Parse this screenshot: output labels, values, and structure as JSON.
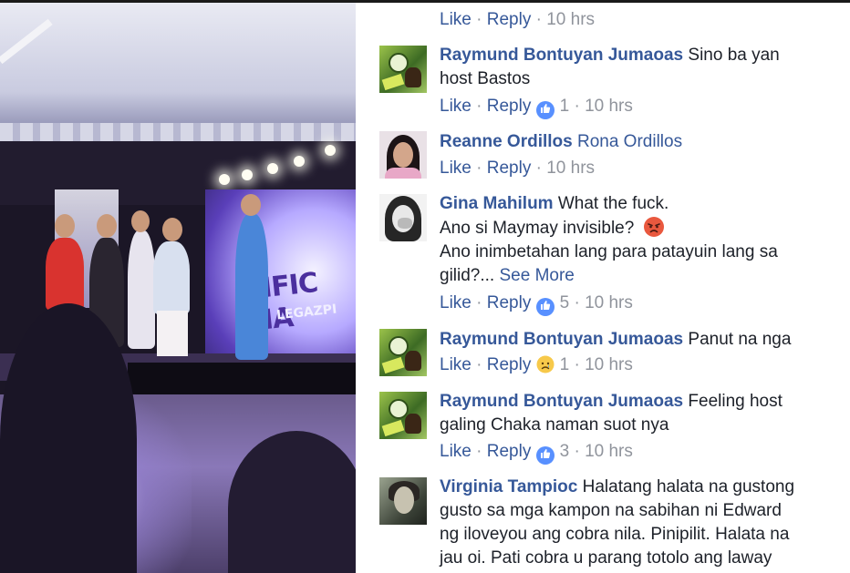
{
  "actions": {
    "like": "Like",
    "reply": "Reply",
    "separator": "·"
  },
  "colors": {
    "link": "#365899",
    "meta": "#90949c",
    "text": "#1d2129",
    "like_blue": "#5890ff"
  },
  "video": {
    "screen_logo_text": "CIFIC MA",
    "screen_logo_sub": "LEGAZPI"
  },
  "first_row": {
    "time": "10 hrs"
  },
  "comments": [
    {
      "author": "Raymund Bontuyan Jumaoas",
      "text_line1": "Sino ba yan",
      "text_line2": "host Bastos",
      "reaction": {
        "icon": "like-icon",
        "count": "1"
      },
      "time": "10 hrs"
    },
    {
      "author": "Reanne Ordillos",
      "text_line1": "Rona Ordillos",
      "time": "10 hrs"
    },
    {
      "author": "Gina Mahilum",
      "text_line1": "What the fuck.",
      "text_line2": "Ano si Maymay invisible?",
      "text_line3": "Ano inimbetahan lang para patayuin lang sa",
      "text_line4": "gilid?...",
      "see_more": "See More",
      "reaction": {
        "icon": "like-icon",
        "count": "5"
      },
      "time": "10 hrs"
    },
    {
      "author": "Raymund Bontuyan Jumaoas",
      "text_line1": "Panut na nga",
      "reaction": {
        "icon": "sad-icon",
        "count": "1"
      },
      "time": "10 hrs"
    },
    {
      "author": "Raymund Bontuyan Jumaoas",
      "text_line1": "Feeling host",
      "text_line2": "galing Chaka naman suot nya",
      "reaction": {
        "icon": "like-icon",
        "count": "3"
      },
      "time": "10 hrs"
    },
    {
      "author": "Virginia Tampioc",
      "text_line1": "Halatang halata na gustong",
      "text_line2": "gusto sa mga kampon na sabihan ni Edward",
      "text_line3": "ng iloveyou ang cobra nila. Pinipilit. Halata na",
      "text_line4": "jau oi. Pati cobra u parang totolo ang laway"
    }
  ]
}
